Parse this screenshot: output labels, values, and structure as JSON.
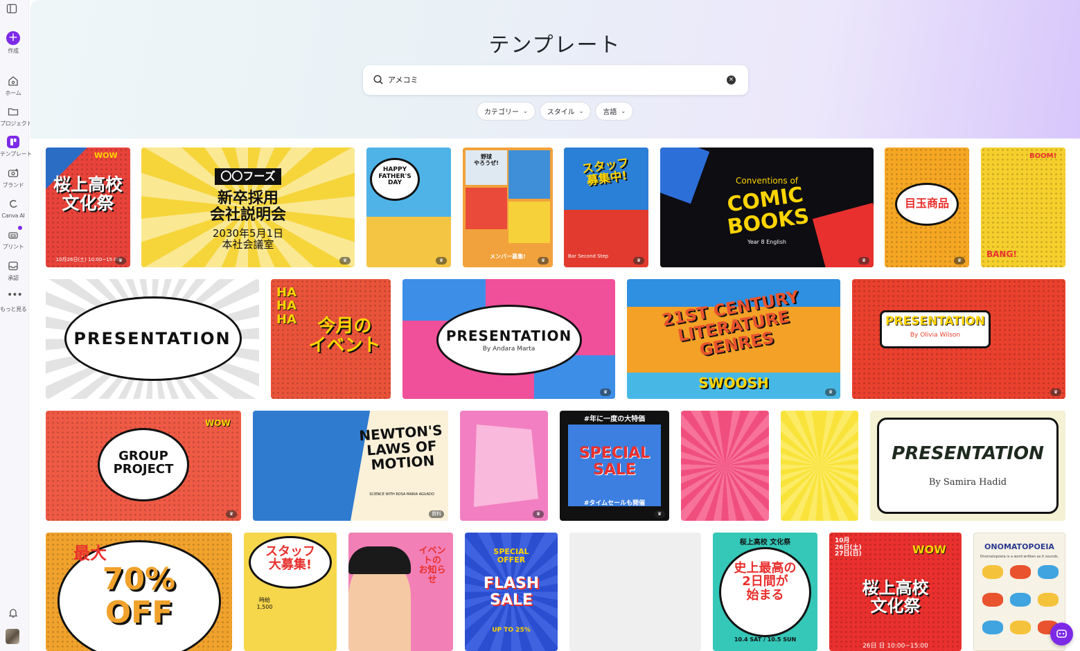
{
  "sidebar": {
    "create_label": "作成",
    "items": [
      {
        "label": "ホーム",
        "icon": "home-icon"
      },
      {
        "label": "プロジェクト",
        "icon": "folder-icon"
      },
      {
        "label": "テンプレート",
        "icon": "template-icon"
      },
      {
        "label": "ブランド",
        "icon": "brand-icon"
      },
      {
        "label": "Canva AI",
        "icon": "canva-ai-icon"
      },
      {
        "label": "プリント",
        "icon": "print-icon"
      },
      {
        "label": "承認",
        "icon": "inbox-icon"
      },
      {
        "label": "もっと見る",
        "icon": "more-icon"
      }
    ]
  },
  "header": {
    "title": "テンプレート",
    "search": {
      "value": "アメコミ",
      "placeholder": ""
    },
    "filters": [
      "カテゴリー",
      "スタイル",
      "言語"
    ]
  },
  "colors": {
    "accent": "#7d2ae8"
  },
  "templates": {
    "t1": {
      "text": "桜上高校\n文化祭",
      "badge": "WOW",
      "footer": "10月26日(土) 10:00~15:00"
    },
    "t2": {
      "brand": "〇〇フーズ",
      "text": "新卒採用\n会社説明会",
      "date": "2030年5月1日\n本社会議室"
    },
    "t3": {
      "text": "HAPPY\nFATHER'S\nDAY"
    },
    "t4": {
      "top": "野球\nやろうぜ!",
      "bottom": "メンバー募集!"
    },
    "t5": {
      "text": "スタッフ\n募集中!",
      "footer": "Bar Second Step"
    },
    "t6": {
      "top": "Conventions of",
      "text": "COMIC\nBOOKS",
      "sub": "Year 8 English"
    },
    "t7": {
      "text": "目玉商品"
    },
    "t8": {
      "top": "BOOM!",
      "bottom": "BANG!"
    },
    "t9": {
      "text": "PRESENTATION"
    },
    "t10": {
      "top": "HA\nHA\nHA",
      "text": "今月の\nイベント"
    },
    "t11": {
      "text": "PRESENTATION",
      "sub": "By Andara Marta"
    },
    "t12": {
      "text": "21ST CENTURY\nLITERATURE\nGENRES",
      "bottom": "SWOOSH"
    },
    "t13": {
      "text": "PRESENTATION",
      "sub": "By Olivia Wilson"
    },
    "t14": {
      "text": "GROUP\nPROJECT",
      "badge": "WOW"
    },
    "t15": {
      "text": "NEWTON'S\nLAWS OF\nMOTION",
      "sub": "SCIENCE WITH ROSA MARIA AGUADO",
      "tag": "資料"
    },
    "t17": {
      "top": "#年に一度の大特価",
      "text": "SPECIAL\nSALE",
      "bottom": "#タイムセールも開催"
    },
    "t20": {
      "text": "PRESENTATION",
      "sub": "By Samira Hadid"
    },
    "t21": {
      "top": "最大",
      "text": "70%\nOFF"
    },
    "t22": {
      "text": "スタッフ\n大募集!",
      "sub": "時給\n1,500"
    },
    "t23": {
      "text": "イベントの\nお知らせ"
    },
    "t24": {
      "top": "SPECIAL\nOFFER",
      "text": "FLASH\nSALE",
      "sub": "UP TO 25%"
    },
    "t26": {
      "top": "桜上高校 文化祭",
      "text": "史上最高の\n2日間が\n始まる",
      "sub": "10.4 SAT / 10.5 SUN"
    },
    "t27": {
      "top": "10月\n26日(土)\n27日(日)",
      "badge": "WOW",
      "text": "桜上高校\n文化祭",
      "footer": "26日 日 10:00~15:00"
    },
    "t28": {
      "text": "ONOMATOPOEIA",
      "sub": "Onomatopoeia is a word written as it sounds."
    }
  }
}
